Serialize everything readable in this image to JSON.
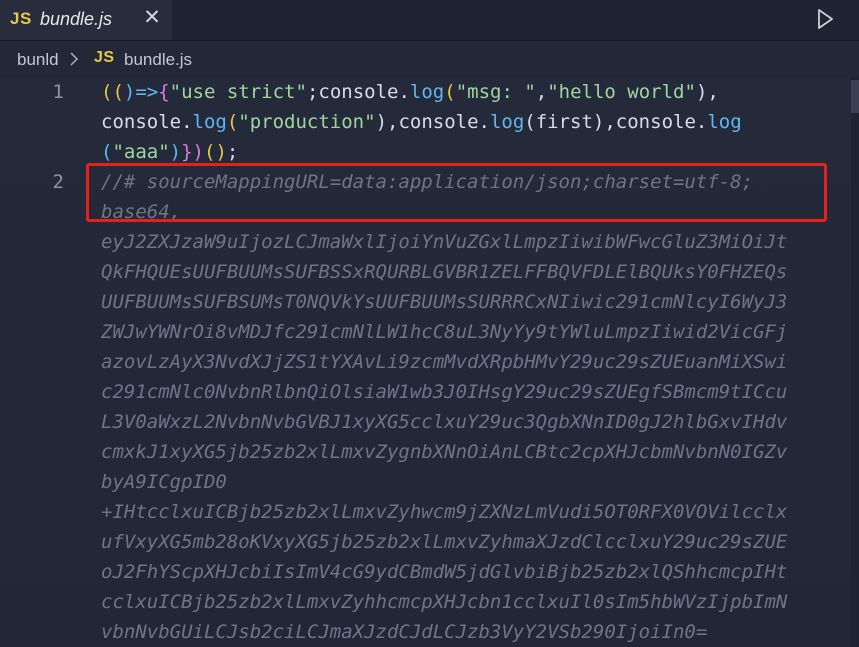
{
  "tab": {
    "icon_text": "JS",
    "title": "bundle.js",
    "close_glyph": "✕"
  },
  "breadcrumb": {
    "folder": "bunld",
    "icon_text": "JS",
    "file": "bundle.js"
  },
  "editor": {
    "line_numbers": [
      "1",
      "2"
    ],
    "line1": {
      "row1": [
        "((",
        ")=>",
        "{",
        "\"use strict\"",
        ";console.",
        "log",
        "(",
        "\"msg: \"",
        ",",
        "\"hello world\"",
        "),"
      ],
      "row2": [
        "console.",
        "log",
        "(",
        "\"production\"",
        "),console.",
        "log",
        "(first),console.",
        "log"
      ],
      "row3": [
        "(",
        "\"aaa\"",
        ")",
        "})",
        "()",
        ";"
      ]
    },
    "line2_rows": [
      "//# sourceMappingURL=data:application/json;charset=utf-8;",
      "base64,",
      "eyJ2ZXJzaW9uIjozLCJmaWxlIjoiYnVuZGxlLmpzIiwibWFwcGluZ3MiOiJt",
      "QkFHQUEsUUFBUUMsSUFBSSxRQURBLGVBR1ZELFFBQVFDLElBQUksY0FHZEQs",
      "UUFBUUMsSUFBSUMsT0NQVkYsUUFBUUMsSURRRCxNIiwic291cmNlcyI6WyJ3",
      "ZWJwYWNrOi8vMDJfc291cmNlLW1hcC8uL3NyYy9tYWluLmpzIiwid2VicGFj",
      "azovLzAyX3NvdXJjZS1tYXAvLi9zcmMvdXRpbHMvY29uc29sZUEuanMiXSwi",
      "c291cmNlc0NvbnRlbnQiOlsiaW1wb3J0IHsgY29uc29sZUEgfSBmcm9tICcu",
      "L3V0aWxzL2NvbnNvbGVBJ1xyXG5cclxuY29uc3QgbXNnID0gJ2hlbGxvIHdv",
      "cmxkJ1xyXG5jb25zb2xlLmxvZygnbXNnOiAnLCBtc2cpXHJcbmNvbnN0IGZv",
      "byA9ICgpID0",
      "+IHtcclxuICBjb25zb2xlLmxvZyhwcm9jZXNzLmVudi5OT0RFX0VOVilcclx",
      "ufVxyXG5mb28oKVxyXG5jb25zb2xlLmxvZyhmaXJzdClcclxuY29uc29sZUE",
      "oJ2FhYScpXHJcbiIsImV4cG9ydCBmdW5jdGlvbiBjb25zb2xlQShhcmcpIHt",
      "cclxuICBjb25zb2xlLmxvZyhhcmcpXHJcbn1cclxuIl0sIm5hbWVzIjpbImN",
      "vbnNvbGUiLCJsb2ciLCJmaXJzdCJdLCJzb3VyY2VSb290IjoiIn0="
    ]
  },
  "colors": {
    "annotation_box": "#e6211c",
    "js_icon": "#e6c84a"
  }
}
